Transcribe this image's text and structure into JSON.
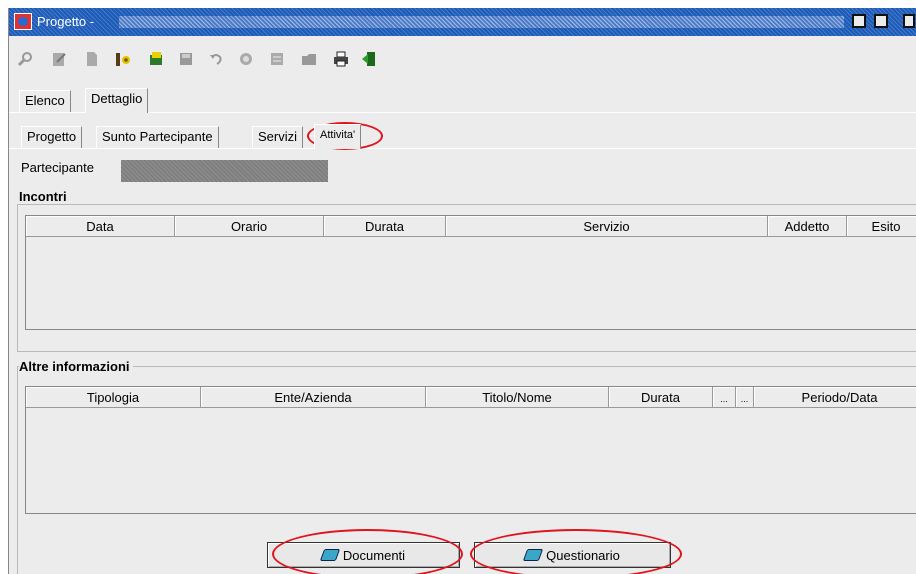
{
  "window": {
    "title": "Progetto -",
    "title_controls": [
      "minimize-icon",
      "maximize-icon",
      "close-icon"
    ]
  },
  "toolbar": {
    "tools": [
      "search-icon",
      "edit-icon",
      "new-document-icon",
      "info-icon",
      "notes-icon",
      "save-icon",
      "undo-icon",
      "help-icon",
      "checklist-icon",
      "folder-icon",
      "print-icon",
      "exit-icon"
    ]
  },
  "main_tabs": [
    "Elenco",
    "Dettaglio"
  ],
  "detail_tabs": [
    "Progetto",
    "Sunto Partecipante",
    "Servizi",
    "Attivita'"
  ],
  "partecipante": {
    "label": "Partecipante",
    "value": ""
  },
  "incontri": {
    "title": "Incontri",
    "columns": [
      "Data",
      "Orario",
      "Durata",
      "Servizio",
      "Addetto",
      "Esito"
    ]
  },
  "altre_informazioni": {
    "title": "Altre informazioni",
    "columns": [
      "Tipologia",
      "Ente/Azienda",
      "Titolo/Nome",
      "Durata",
      "...",
      "...",
      "Periodo/Data"
    ]
  },
  "buttons": {
    "documenti": "Documenti",
    "questionario": "Questionario"
  },
  "colors": {
    "titlebar": "#1c5bb8",
    "highlight": "#e0121c",
    "background": "#ececec"
  }
}
